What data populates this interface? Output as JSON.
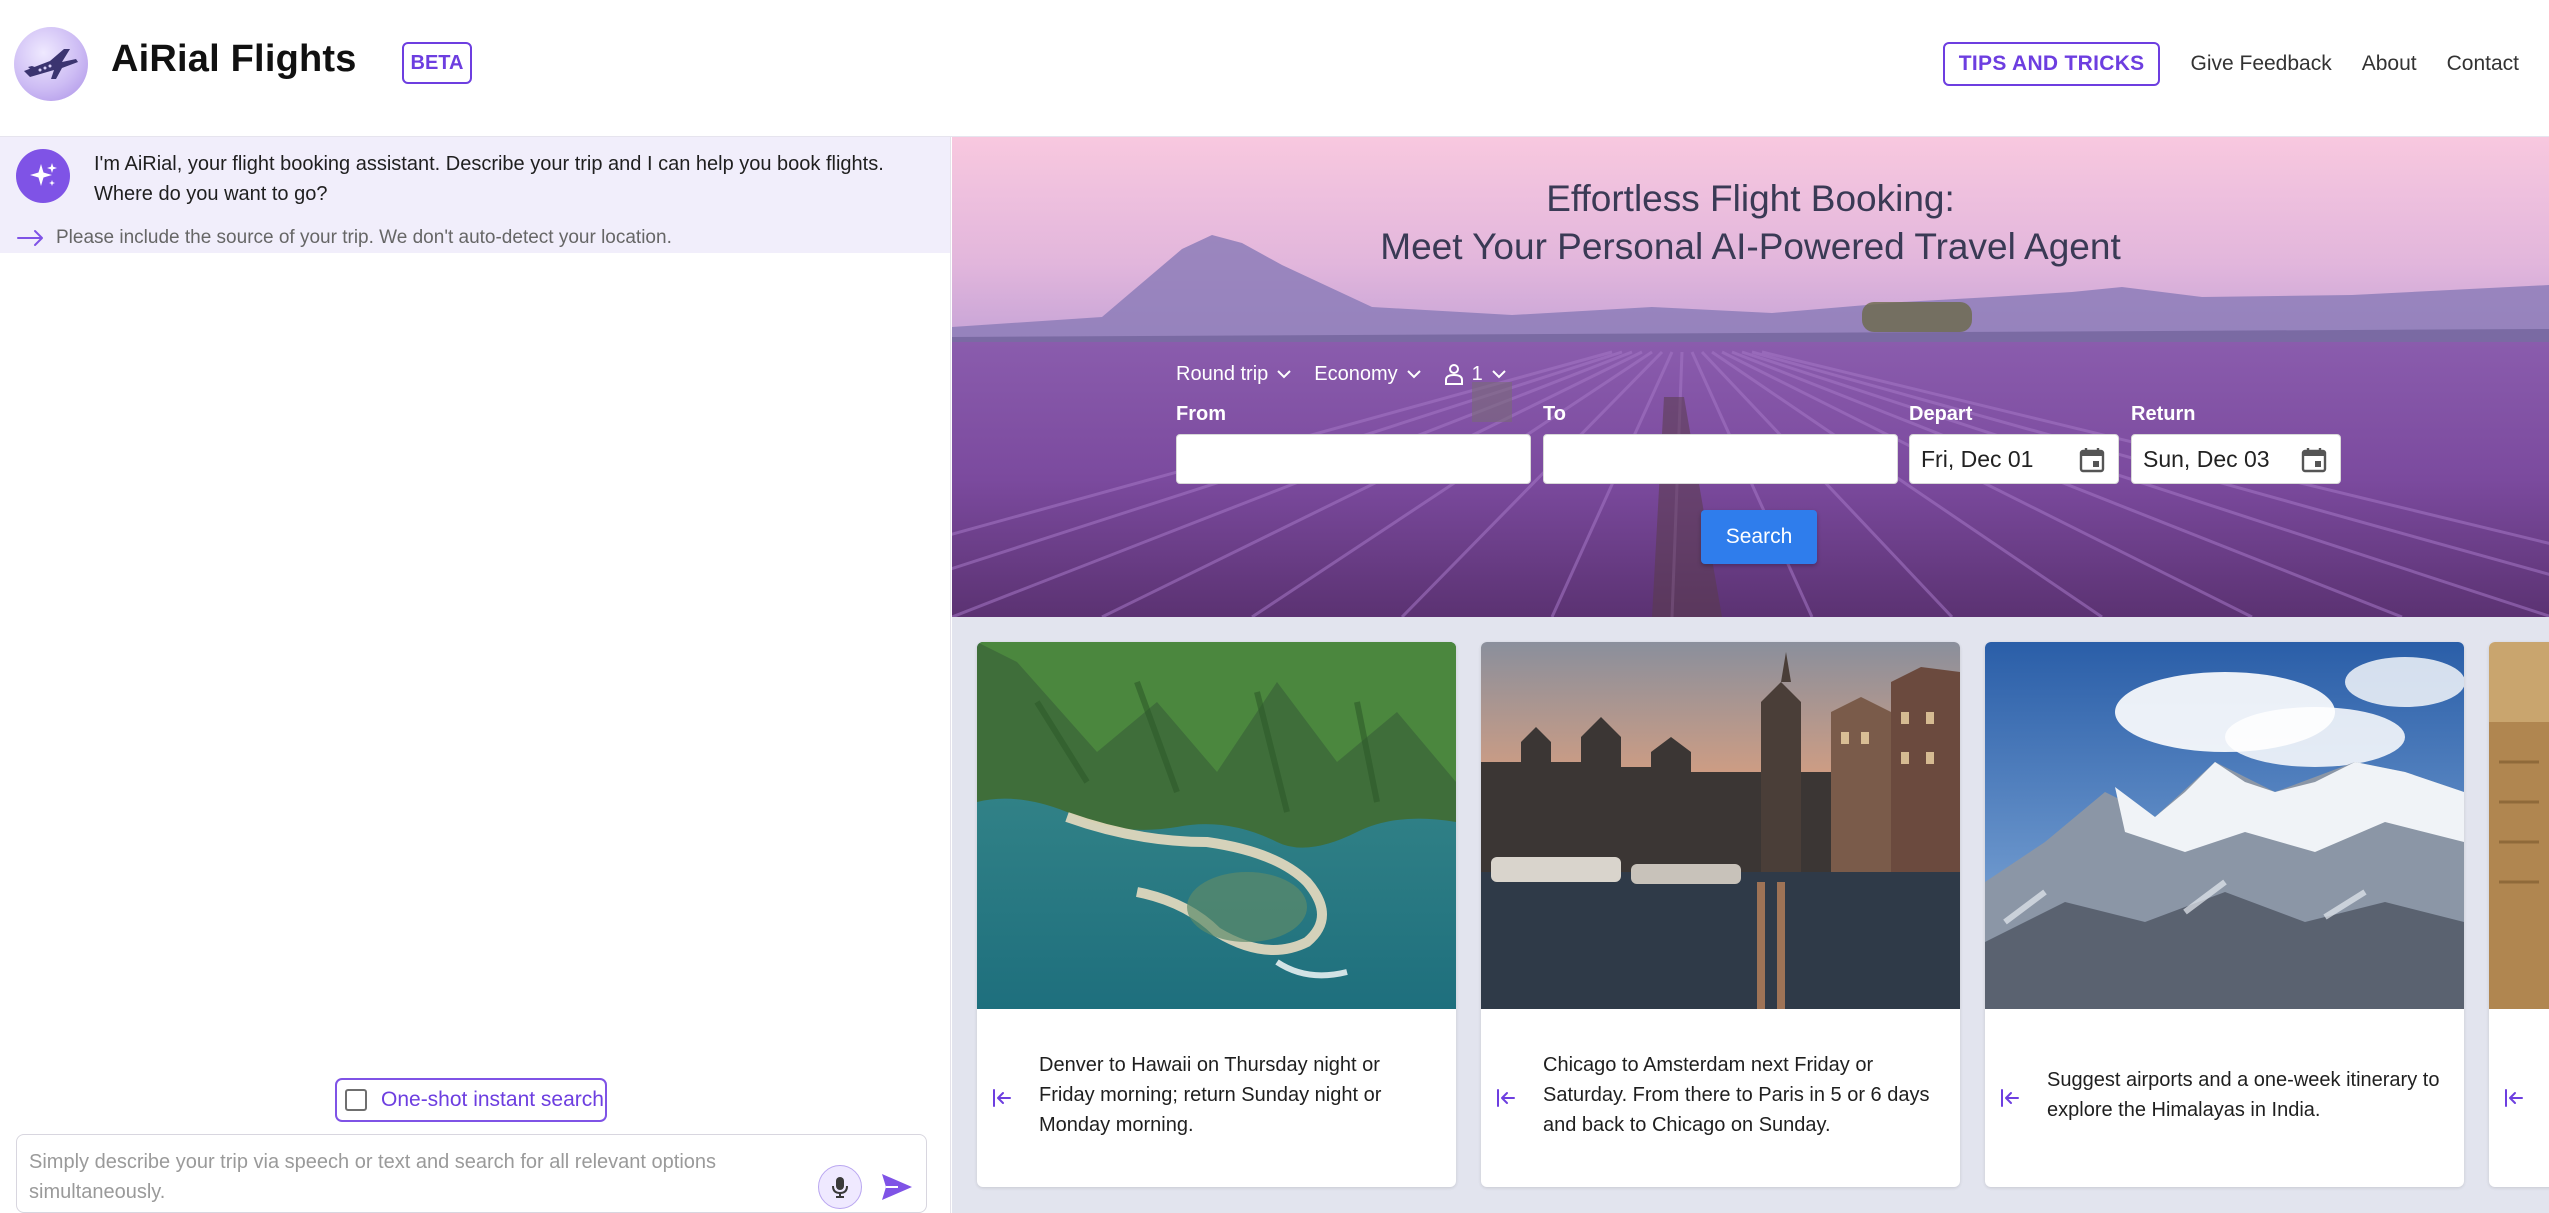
{
  "header": {
    "app_title": "AiRial Flights",
    "beta_label": "BETA",
    "nav": {
      "tips_label": "TIPS AND TRICKS",
      "feedback_label": "Give Feedback",
      "about_label": "About",
      "contact_label": "Contact"
    }
  },
  "chat": {
    "assistant_message": "I'm AiRial, your flight booking assistant. Describe your trip and I can help you book flights. Where do you want to go?",
    "hint": "Please include the source of your trip. We don't auto-detect your location.",
    "oneshot_label": "One-shot instant search",
    "oneshot_checked": false,
    "input_placeholder": "Simply describe your trip via speech or text and search for all relevant options simultaneously.",
    "input_value": ""
  },
  "hero": {
    "title_line1": "Effortless Flight Booking:",
    "title_line2": "Meet Your Personal AI-Powered Travel Agent",
    "trip_type": "Round trip",
    "cabin_class": "Economy",
    "passengers": "1",
    "from_label": "From",
    "from_value": "",
    "to_label": "To",
    "to_value": "",
    "depart_label": "Depart",
    "depart_value": "Fri, Dec 01",
    "return_label": "Return",
    "return_value": "Sun, Dec 03",
    "search_label": "Search"
  },
  "cards": [
    {
      "text": "Denver to Hawaii on Thursday night or Friday morning; return Sunday night or Monday morning.",
      "image": "hawaii-coast"
    },
    {
      "text": "Chicago to Amsterdam next Friday or Saturday. From there to Paris in 5 or 6 days and back to Chicago on Sunday.",
      "image": "amsterdam-canal"
    },
    {
      "text": "Suggest airports and a one-week itinerary to explore the Himalayas in India.",
      "image": "himalayas"
    }
  ],
  "colors": {
    "accent": "#6d3ee0",
    "primary_button": "#2f7dec",
    "assistant_bg": "#f1eefb",
    "cards_bg": "#e2e4ee"
  },
  "icons": {
    "logo": "airplane-logo-icon",
    "assistant": "sparkle-icon",
    "hint": "arrow-right-icon",
    "mic": "microphone-icon",
    "send": "send-icon",
    "calendar": "calendar-icon",
    "card_action": "arrow-to-left-icon"
  }
}
